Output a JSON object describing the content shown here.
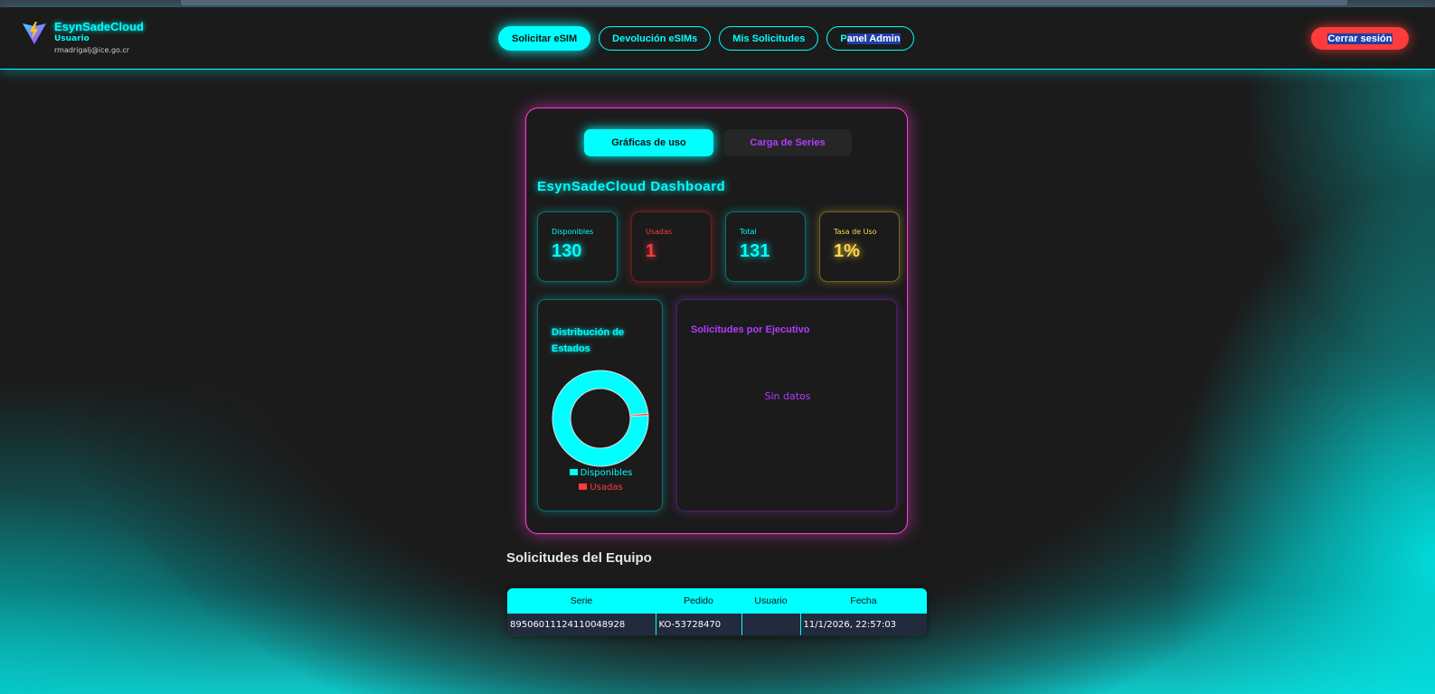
{
  "header": {
    "app_name": "EsynSadeCloud",
    "role": "Usuario",
    "email": "rmadrigalj@ice.go.cr",
    "nav": [
      {
        "label": "Solicitar eSIM",
        "active": true
      },
      {
        "label": "Devolución eSIMs",
        "active": false
      },
      {
        "label": "Mis Solicitudes",
        "active": false
      },
      {
        "label_pre": "P",
        "label_highlight": "anel Admin",
        "active": false
      }
    ],
    "logout_label": "Cerrar sesión"
  },
  "dashboard": {
    "tabs": [
      {
        "label": "Gráficas de uso",
        "active": true
      },
      {
        "label": "Carga de Series",
        "active": false
      }
    ],
    "title": "EsynSadeCloud Dashboard",
    "stats": [
      {
        "label": "Disponibles",
        "value": "130",
        "color": "#00ffff"
      },
      {
        "label": "Usadas",
        "value": "1",
        "color": "#ff3b3b"
      },
      {
        "label": "Total",
        "value": "131",
        "color": "#00ffff"
      },
      {
        "label": "Tasa de Uso",
        "value": "1%",
        "color": "#ffd84a"
      }
    ],
    "distribution": {
      "title": "Distribución de Estados",
      "legend": [
        {
          "label": "Disponibles",
          "color": "#00ffff"
        },
        {
          "label": "Usadas",
          "color": "#ff3b3b"
        }
      ]
    },
    "executives": {
      "title": "Solicitudes por Ejecutivo",
      "empty_text": "Sin datos"
    }
  },
  "chart_data": {
    "type": "pie",
    "categories": [
      "Disponibles",
      "Usadas"
    ],
    "values": [
      130,
      1
    ],
    "colors": [
      "#00ffff",
      "#ff3b3b"
    ]
  },
  "team": {
    "title": "Solicitudes del Equipo",
    "columns": [
      "Serie",
      "Pedido",
      "Usuario",
      "Fecha"
    ],
    "rows": [
      [
        "8950601112411004892​8",
        "KO-53728470",
        "",
        "11/1/2026, 22:57:03"
      ]
    ]
  }
}
